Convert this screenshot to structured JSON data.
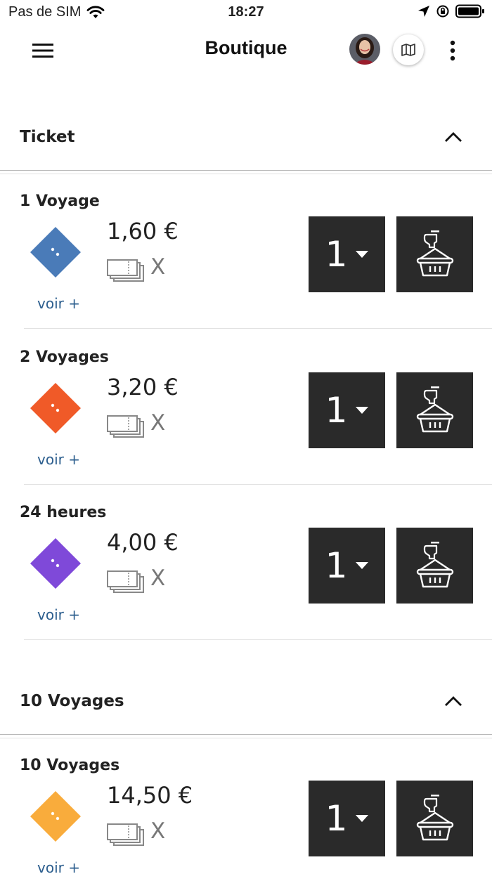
{
  "status_bar": {
    "carrier": "Pas de SIM",
    "time": "18:27"
  },
  "header": {
    "title": "Boutique"
  },
  "sections": [
    {
      "title": "Ticket",
      "products": [
        {
          "name": "1 Voyage",
          "price": "1,60 €",
          "multiplier": "X",
          "more_link": "voir +",
          "quantity": "1",
          "color": "#4a7bb8"
        },
        {
          "name": "2 Voyages",
          "price": "3,20 €",
          "multiplier": "X",
          "more_link": "voir +",
          "quantity": "1",
          "color": "#f05a28"
        },
        {
          "name": "24 heures",
          "price": "4,00 €",
          "multiplier": "X",
          "more_link": "voir +",
          "quantity": "1",
          "color": "#7f49d9"
        }
      ]
    },
    {
      "title": "10 Voyages",
      "products": [
        {
          "name": "10 Voyages",
          "price": "14,50 €",
          "multiplier": "X",
          "more_link": "voir +",
          "quantity": "1",
          "color": "#f9ac3c"
        }
      ]
    }
  ],
  "icons": {
    "menu": "menu-icon",
    "map": "map-icon",
    "more": "more-vertical-icon",
    "chevron": "chevron-up-icon",
    "tickets": "tickets-stack-icon",
    "caret": "caret-down-icon",
    "cart": "basket-icon"
  }
}
